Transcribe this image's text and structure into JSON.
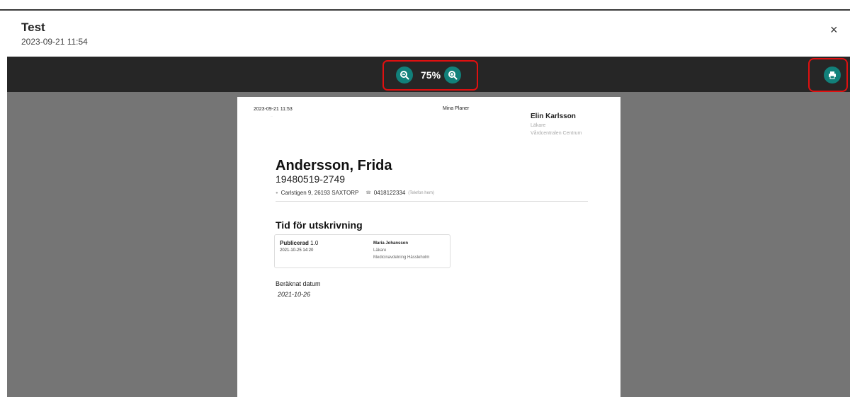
{
  "header": {
    "title": "Test",
    "subtitle": "2023-09-21 11:54",
    "close_label": "×"
  },
  "toolbar": {
    "zoom_level": "75%",
    "zoom_out_icon": "zoom-out-icon",
    "zoom_in_icon": "zoom-in-icon",
    "print_icon": "print-icon",
    "accent_color": "#12807a",
    "highlight_color": "#e01010"
  },
  "document": {
    "printed_at": "2023-09-21 11:53",
    "mini_text": "...",
    "app_name": "Mina Planer",
    "author": {
      "name": "Elin Karlsson",
      "role": "Läkare",
      "unit": "Vårdcentralen Centrum"
    },
    "patient": {
      "name": "Andersson, Frida",
      "id": "19480519-2749",
      "address": "Carlstigen 9, 26193 SAXTORP",
      "phone": "0418122334",
      "phone_type": "(Telefon hem)"
    },
    "section_title": "Tid för utskrivning",
    "card": {
      "status_label": "Publicerad",
      "version": "1.0",
      "datetime": "2021-10-25 14:20",
      "person": "Maria Johansson",
      "person_role": "Läkare",
      "person_unit": "Medicinavdelning Hässleholm"
    },
    "calc_label": "Beräknat datum",
    "calc_value": "2021-10-26"
  }
}
